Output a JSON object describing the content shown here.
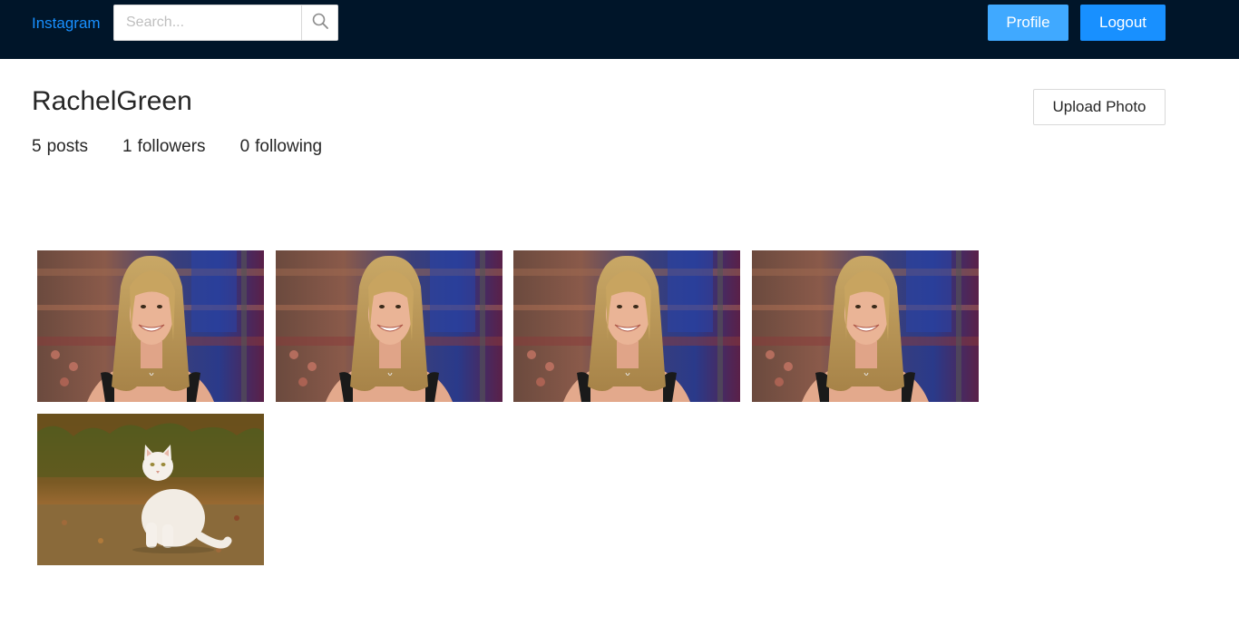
{
  "navbar": {
    "brand": "Instagram",
    "search_placeholder": "Search...",
    "search_icon": "magnifier-icon",
    "profile_label": "Profile",
    "logout_label": "Logout"
  },
  "profile": {
    "username": "RachelGreen",
    "upload_label": "Upload Photo",
    "stats": {
      "posts_count": "5",
      "posts_label": "posts",
      "followers_count": "1",
      "followers_label": "followers",
      "following_count": "0",
      "following_label": "following"
    }
  },
  "photos": [
    {
      "subject": "smiling-woman-photo"
    },
    {
      "subject": "smiling-woman-photo"
    },
    {
      "subject": "smiling-woman-photo"
    },
    {
      "subject": "smiling-woman-photo"
    },
    {
      "subject": "white-cat-photo"
    }
  ],
  "colors": {
    "navbar_bg": "#001529",
    "brand": "#1890ff",
    "profile_button": "#40a9ff",
    "logout_button": "#1890ff"
  }
}
